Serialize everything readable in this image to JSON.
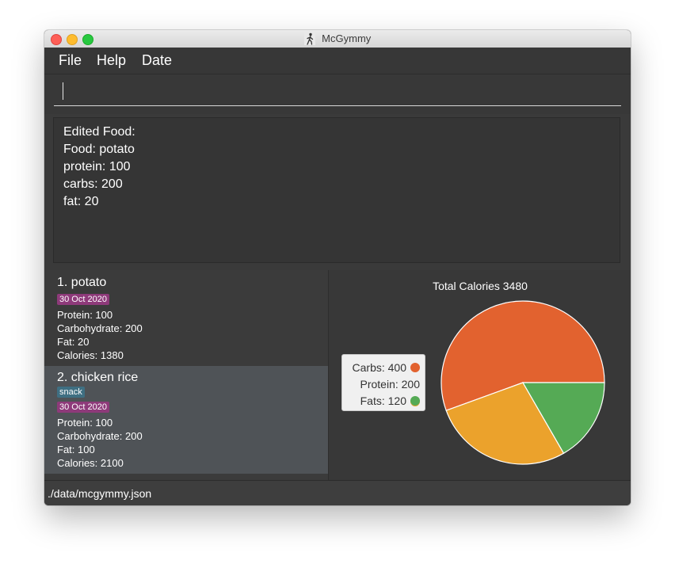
{
  "window": {
    "title": "McGymmy",
    "icon": "runner-icon"
  },
  "menu": {
    "file": "File",
    "help": "Help",
    "date": "Date"
  },
  "command": {
    "value": ""
  },
  "result": {
    "line1": "Edited Food:",
    "line2": "Food: potato",
    "line3": "protein: 100",
    "line4": "carbs: 200",
    "line5": "fat: 20"
  },
  "foods": [
    {
      "name": "1.  potato",
      "date": "30 Oct 2020",
      "protein": "Protein: 100",
      "carbs": "Carbohydrate: 200",
      "fat": "Fat: 20",
      "calories": "Calories: 1380"
    },
    {
      "name": "2.  chicken rice",
      "tag": "snack",
      "date": "30 Oct 2020",
      "protein": "Protein: 100",
      "carbs": "Carbohydrate: 200",
      "fat": "Fat: 100",
      "calories": "Calories: 2100"
    }
  ],
  "chart_data": {
    "type": "pie",
    "title": "Total Calories 3480",
    "categories": [
      "Carbs",
      "Protein",
      "Fats"
    ],
    "values": [
      400,
      200,
      120
    ],
    "legend_labels": [
      "Carbs: 400",
      "Protein: 200",
      "Fats: 120"
    ],
    "colors": [
      "#e2622f",
      "#eba22c",
      "#55aa55"
    ],
    "legend": "left",
    "start_angle_deg": 0,
    "direction": "counterclockwise"
  },
  "status": {
    "path": "./data/mcgymmy.json"
  }
}
